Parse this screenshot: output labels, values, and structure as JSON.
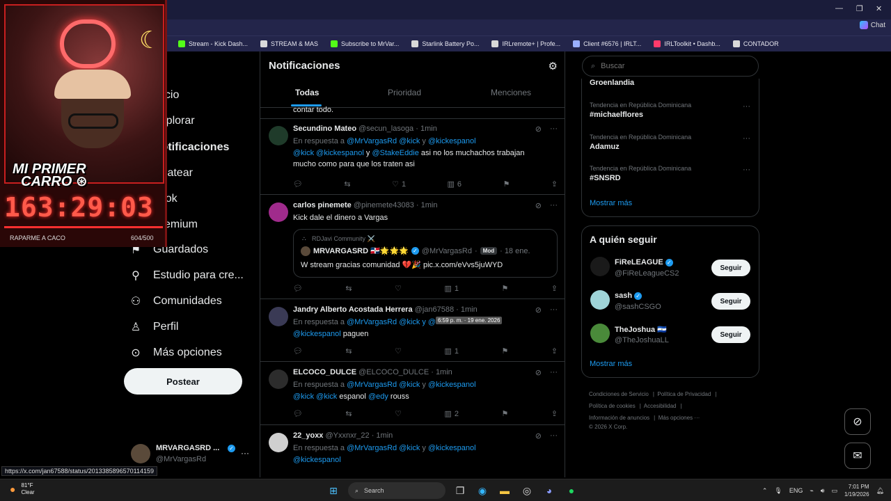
{
  "bookmarks": [
    {
      "label": "Stream - Kick Dash...",
      "icon": "kick-icon",
      "color": "#53fc18"
    },
    {
      "label": "STREAM & MAS",
      "icon": "folder-icon",
      "color": "#d9d9d9"
    },
    {
      "label": "Subscribe to MrVar...",
      "icon": "kick-icon",
      "color": "#53fc18"
    },
    {
      "label": "Starlink Battery Po...",
      "icon": "doc-icon",
      "color": "#d9d9d9"
    },
    {
      "label": "IRLremote+ | Profe...",
      "icon": "globe-icon",
      "color": "#d9d9d9"
    },
    {
      "label": "Client #6576 | IRLT...",
      "icon": "star-icon",
      "color": "#9ab0ff"
    },
    {
      "label": "IRLToolkit • Dashb...",
      "icon": "toolkit-icon",
      "color": "#ff3b6b"
    },
    {
      "label": "CONTADOR",
      "icon": "contador-icon",
      "color": "#d9d9d9"
    }
  ],
  "toolbar": {
    "chat_label": "Chat"
  },
  "nav": {
    "items": [
      {
        "label": "Inicio",
        "icon": "home-icon"
      },
      {
        "label": "Explorar",
        "icon": "search-icon"
      },
      {
        "label": "Notificaciones",
        "icon": "bell-icon"
      },
      {
        "label": "Chatear",
        "icon": "chat-icon"
      },
      {
        "label": "Grok",
        "icon": "grok-icon"
      },
      {
        "label": "Premium",
        "icon": "x-icon"
      },
      {
        "label": "Guardados",
        "icon": "bookmark-icon"
      },
      {
        "label": "Estudio para cre...",
        "icon": "studio-icon"
      },
      {
        "label": "Comunidades",
        "icon": "communities-icon"
      },
      {
        "label": "Perfil",
        "icon": "profile-icon"
      },
      {
        "label": "Más opciones",
        "icon": "more-icon"
      }
    ],
    "post_label": "Postear",
    "account": {
      "name": "MRVARGASRD ...",
      "handle": "@MrVargasRd"
    }
  },
  "notifications": {
    "title": "Notificaciones",
    "tabs": [
      "Todas",
      "Prioridad",
      "Menciones"
    ],
    "truncated_text": "contar todo.",
    "posts": [
      {
        "name": "Secundino Mateo",
        "handle": "@secun_lasoga",
        "time": "· 1min",
        "reply_prefix": "En respuesta a",
        "reply_to": "@MrVargasRd @kick",
        "reply_and": "y",
        "reply_last": "@kickespanol",
        "text_mentions": "@kick @kickespanol",
        "text_mid": "y",
        "text_mention2": "@StakeEddie",
        "text": "  asi no los muchachos trabajan",
        "text2": "mucho como para que los traten asi",
        "likes": "1",
        "views": "6",
        "avatar_color": "#1f3b2a"
      },
      {
        "name": "carlos pinemete",
        "handle": "@pinemete43083",
        "time": "· 1min",
        "text": "Kick dale el dinero a Vargas",
        "quote": {
          "community": "RDJavi Community ⚔️",
          "name": "MRVARGASRD 🇩🇴🌟🌟🌟",
          "handle": "@MrVargasRd",
          "badge": "Mod",
          "date": "· 18 ene.",
          "text": "W stream gracias comunidad 💔🎉 pic.x.com/eVvs5juWYD"
        },
        "views": "1",
        "avatar_color": "#a02b8c"
      },
      {
        "name": "Jandry Alberto Acostada Herrera",
        "handle": "@jan67588",
        "time": "· 1min",
        "reply_prefix": "En respuesta a",
        "reply_to": "@MrVargasRd @kick y @ki",
        "text_mention": "@kickespanol",
        "text": " paguen",
        "views": "1",
        "avatar_color": "#3a3a55"
      },
      {
        "name": "ELCOCO_DULCE",
        "handle": "@ELCOCO_DULCE",
        "time": "· 1min",
        "reply_prefix": "En respuesta a",
        "reply_to": "@MrVargasRd @kick",
        "reply_and": "y",
        "reply_last": "@kickespanol",
        "text_mentions": "@kick @kick",
        "text": " espanol ",
        "text_mention2": "@edy",
        "text_end": " rouss",
        "views": "2",
        "avatar_color": "#2c2c2c"
      },
      {
        "name": "22_yoxx",
        "handle": "@Yxxnxr_22",
        "time": "· 1min",
        "reply_prefix": "En respuesta a",
        "reply_to": "@MrVargasRd @kick",
        "reply_and": "y",
        "reply_last": "@kickespanol",
        "text_mention": "@kickespanol",
        "avatar_color": "#cfcfcf"
      }
    ]
  },
  "hover_tooltip": "6:59 p. m. · 19 ene. 2026",
  "search": {
    "placeholder": "Buscar"
  },
  "trends": {
    "top_name": "Groenlandia",
    "items": [
      {
        "context": "Tendencia en República Dominicana",
        "name": "#michaelflores"
      },
      {
        "context": "Tendencia en República Dominicana",
        "name": "Adamuz"
      },
      {
        "context": "Tendencia en República Dominicana",
        "name": "#SNSRD"
      }
    ],
    "show_more": "Mostrar más"
  },
  "who_to_follow": {
    "title": "A quién seguir",
    "follow_label": "Seguir",
    "items": [
      {
        "name": "FiReLEAGUE",
        "handle": "@FiReLeagueCS2",
        "avatar_color": "#1a1a1a"
      },
      {
        "name": "sash",
        "handle": "@sashCSGO",
        "avatar_color": "#9fd4d8"
      },
      {
        "name": "TheJoshua 🇸🇻",
        "handle": "@TheJoshuaLL",
        "avatar_color": "#4a8a3a"
      }
    ],
    "show_more": "Mostrar más"
  },
  "footer": {
    "links": [
      "Condiciones de Servicio",
      "Política de Privacidad",
      "Política de cookies",
      "Accesibilidad",
      "Información de anuncios",
      "Más opciones ···"
    ],
    "copyright": "© 2026 X Corp."
  },
  "overlay": {
    "title_line1": "MI PRIMER",
    "title_line2": "CARRO",
    "timer": "163:29:03",
    "label": "RAPARME A CACO",
    "count": "604/500",
    "progress": 1.0
  },
  "status_url": "https://x.com/jan67588/status/2013385896570114159",
  "taskbar": {
    "weather_temp": "81°F",
    "weather_desc": "Clear",
    "search_label": "Search",
    "lang": "ENG",
    "time": "7:01 PM",
    "date": "1/19/2026"
  }
}
